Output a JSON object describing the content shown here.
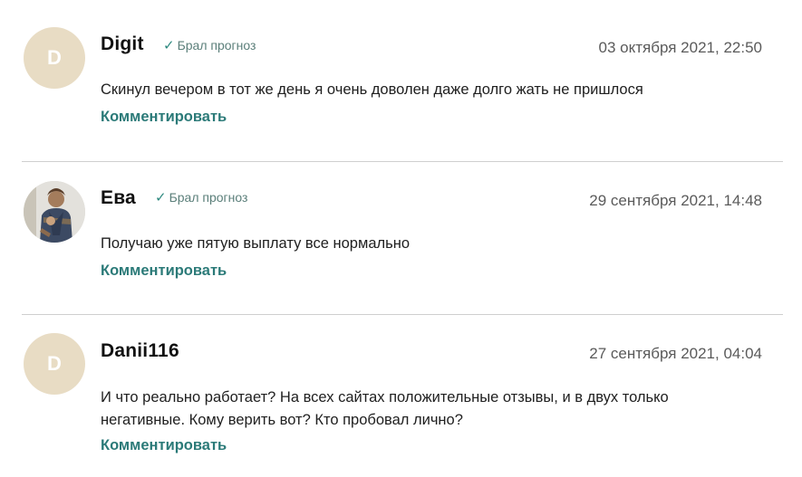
{
  "comments": [
    {
      "author": "Digit",
      "avatar_letter": "D",
      "verified": "Брал прогноз",
      "date": "03 октября 2021, 22:50",
      "text": "Скинул вечером в тот же день я очень доволен даже долго жать не пришлося",
      "reply_label": "Комментировать"
    },
    {
      "author": "Ева",
      "avatar_letter": "",
      "verified": "Брал прогноз",
      "date": "29 сентября 2021, 14:48",
      "text": "Получаю уже пятую выплату все нормально",
      "reply_label": "Комментировать"
    },
    {
      "author": "Danii116",
      "avatar_letter": "D",
      "verified": "",
      "date": "27 сентября 2021, 04:04",
      "text": "И что реально работает? На всех сайтах положительные отзывы, и в двух только негативные. Кому верить вот? Кто пробовал лично?",
      "reply_label": "Комментировать"
    }
  ],
  "colors": {
    "accent": "#2b7a78",
    "avatar_bg": "#e8dcc4",
    "divider": "#cfcfcf"
  },
  "icons": {
    "verified": "checkmark-icon"
  }
}
